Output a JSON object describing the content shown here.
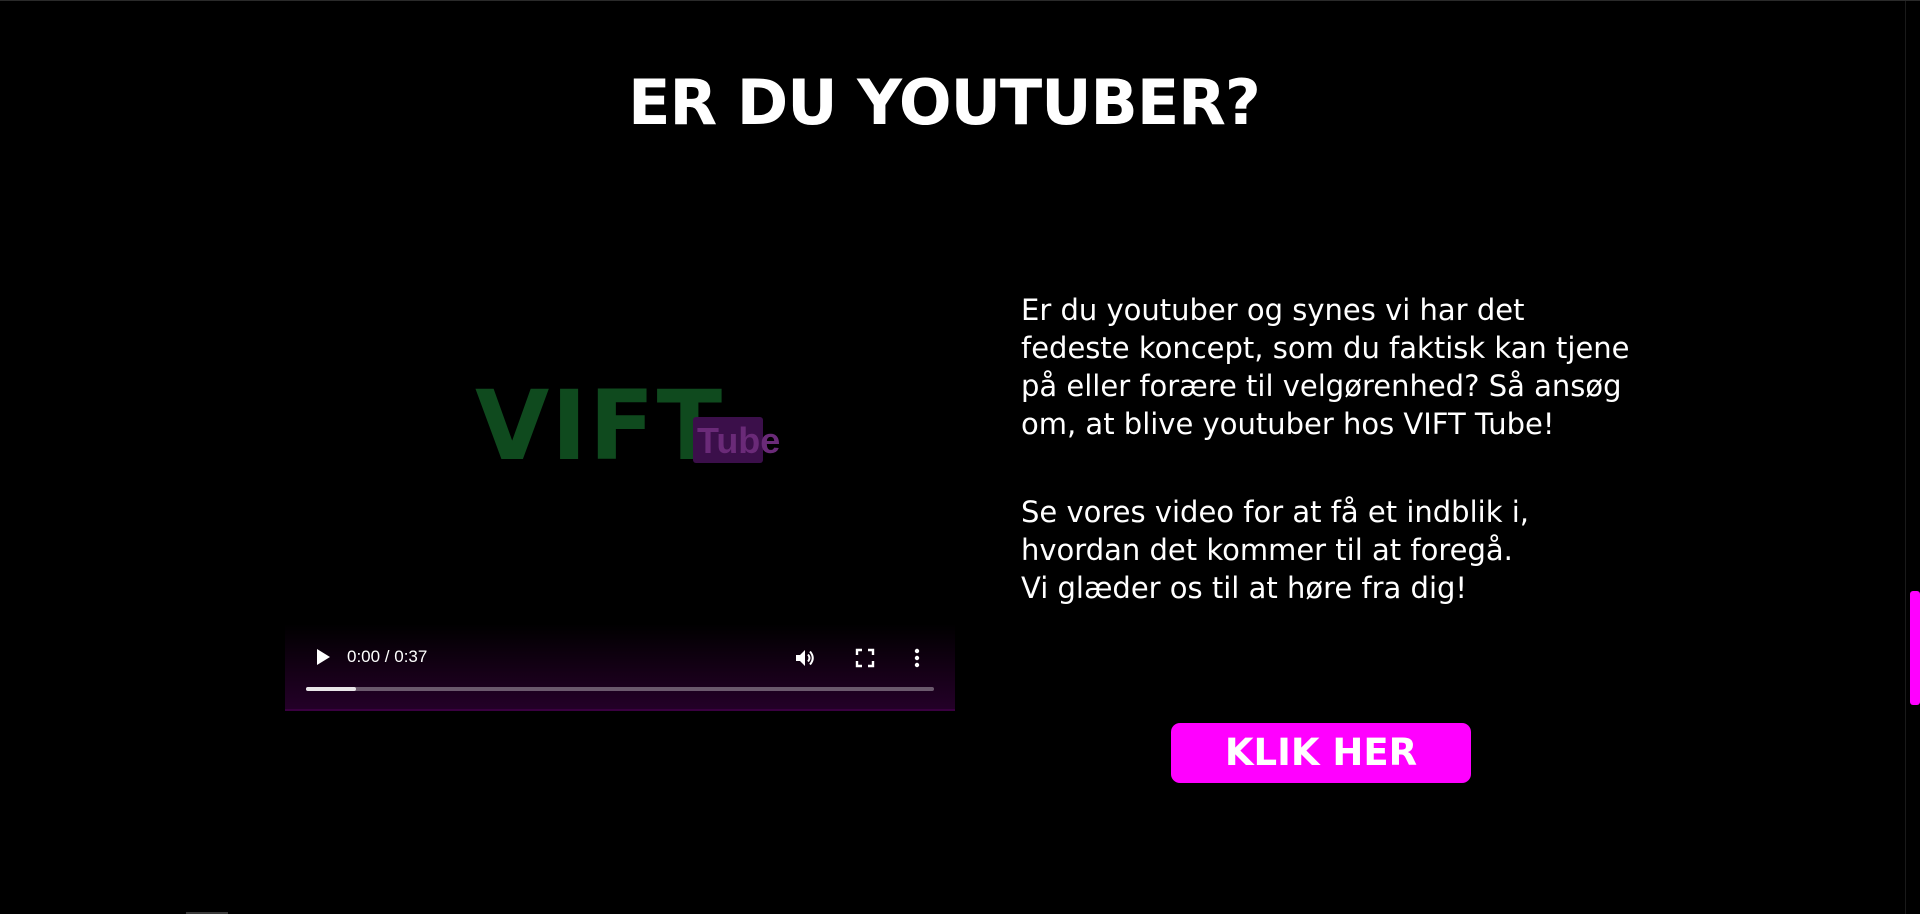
{
  "heading": "ER DU YOUTUBER?",
  "video": {
    "poster_logo_main": "VIFT",
    "poster_logo_sub": "Tube",
    "time_display": "0:00 / 0:37",
    "progress_buffered": 0.08,
    "icons": {
      "play": "play-icon",
      "volume": "volume-icon",
      "fullscreen": "fullscreen-icon",
      "more": "more-options-icon"
    }
  },
  "text": {
    "paragraph1": "Er du youtuber og synes vi har det fedeste koncept, som du faktisk kan tjene på eller forære til velgørenhed? Så ansøg om, at blive youtuber hos VIFT Tube!",
    "paragraph2_line1": "Se vores video for at få et indblik i,",
    "paragraph2_line2": "hvordan det kommer til at foregå.",
    "paragraph2_line3": "Vi glæder os til at høre fra dig!"
  },
  "cta_label": "KLIK HER",
  "colors": {
    "background": "#000000",
    "accent": "#ff00ff",
    "text": "#ffffff",
    "logo_green": "#0f4a1e",
    "logo_purple": "#3b0f4a"
  }
}
